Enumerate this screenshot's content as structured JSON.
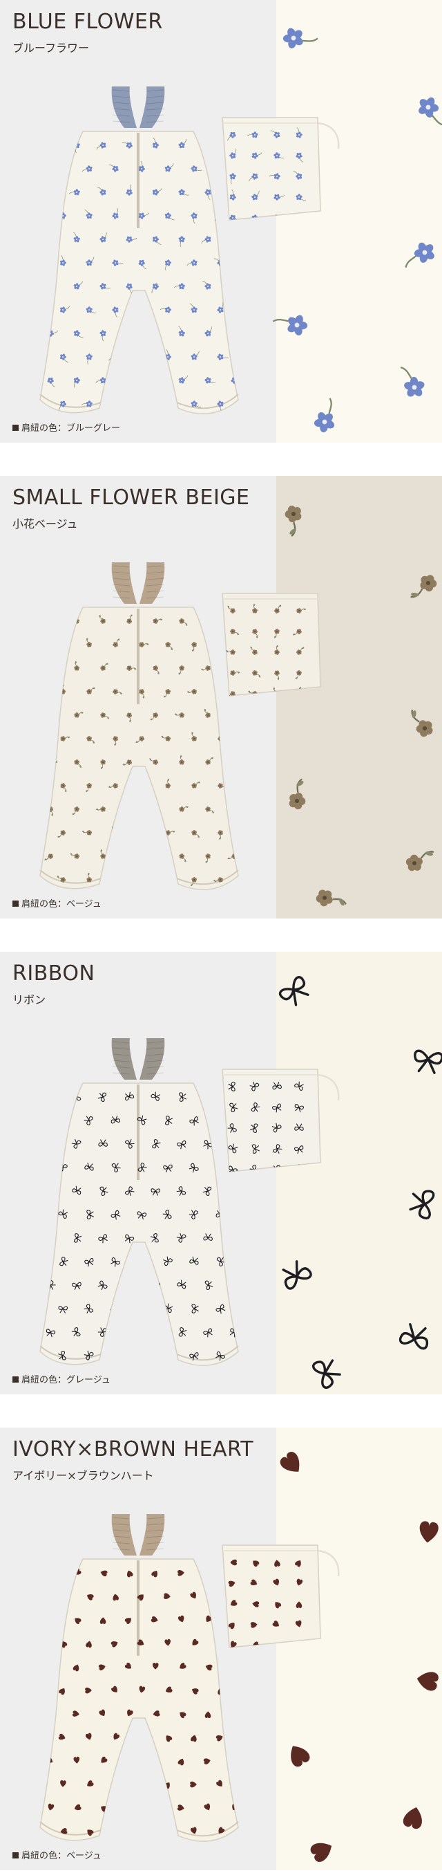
{
  "colors": {
    "page_bg": "#ffffff",
    "panel_bg": "#eeeeee",
    "text": "#3a2f2a"
  },
  "strap_prefix": "肩紐の色：",
  "sections": [
    {
      "title": "BLUE FLOWER",
      "subtitle": "ブルーフラワー",
      "strap_color": "ブルーグレー",
      "motif": "blue-flower-icon",
      "motif_color": "#6f86c9",
      "strap_hex": "#8d9bb6",
      "fabric_hex": "#f6f3ea",
      "right_bg": "#fbf9f0"
    },
    {
      "title": "SMALL FLOWER BEIGE",
      "subtitle": "小花ベージュ",
      "strap_color": "ベージュ",
      "motif": "small-flower-icon",
      "motif_color": "#8f7b5e",
      "strap_hex": "#b8a48c",
      "fabric_hex": "#f3efe5",
      "right_bg": "#e6dfd3"
    },
    {
      "title": "RIBBON",
      "subtitle": "リボン",
      "strap_color": "グレージュ",
      "motif": "ribbon-icon",
      "motif_color": "#1d1d22",
      "strap_hex": "#9a958c",
      "fabric_hex": "#f3f1ea",
      "right_bg": "#f8f5e8"
    },
    {
      "title": "IVORY×BROWN HEART",
      "subtitle": "アイボリー×ブラウンハート",
      "strap_color": "ベージュ",
      "motif": "heart-icon",
      "motif_color": "#5a2a22",
      "strap_hex": "#b8a48c",
      "fabric_hex": "#f6f2e6",
      "right_bg": "#fbf8ee"
    }
  ]
}
